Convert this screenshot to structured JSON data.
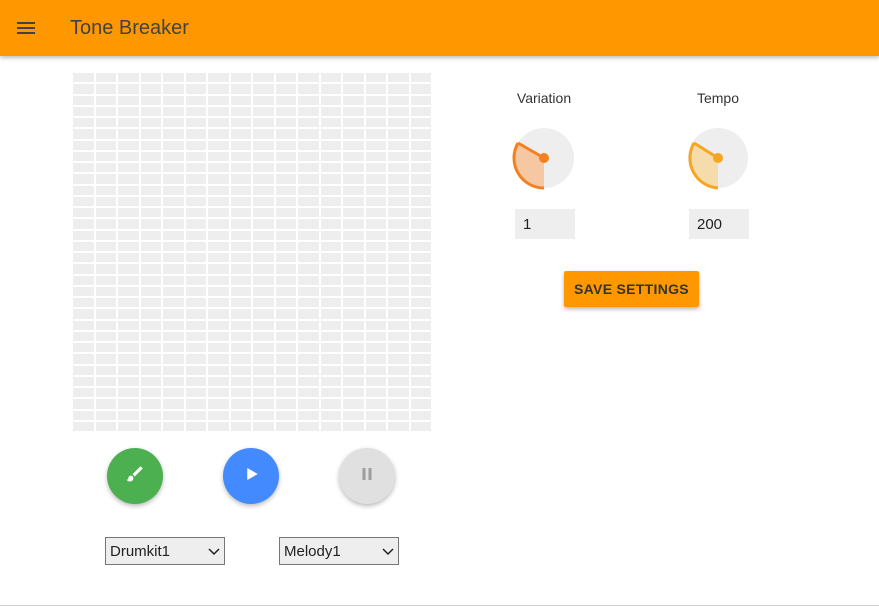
{
  "appbar": {
    "title": "Tone Breaker",
    "menu_icon": "menu-icon",
    "color": "#ff9800"
  },
  "sequencer": {
    "columns": 16,
    "rows": 32,
    "cell_color": "#eeeeee"
  },
  "controls": {
    "brush_icon": "brush-icon",
    "brush_color": "#4caf50",
    "play_icon": "play-icon",
    "play_color": "#448aff",
    "pause_icon": "pause-icon",
    "pause_color": "#e0e0e0"
  },
  "selects": {
    "drumkit": {
      "value": "Drumkit1"
    },
    "melody": {
      "value": "Melody1"
    }
  },
  "settings": {
    "variation": {
      "label": "Variation",
      "value": "1",
      "knob_color": "#f4801f"
    },
    "tempo": {
      "label": "Tempo",
      "value": "200",
      "knob_color": "#f6a623"
    },
    "save_label": "SAVE SETTINGS"
  }
}
